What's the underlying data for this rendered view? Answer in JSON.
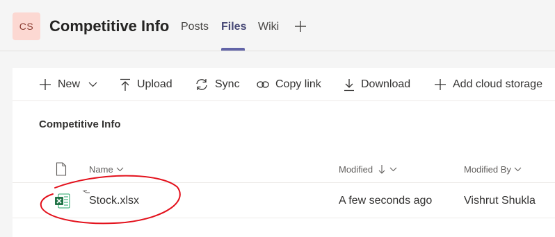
{
  "header": {
    "avatar_initials": "CS",
    "channel_title": "Competitive Info",
    "tabs": [
      {
        "label": "Posts",
        "active": false
      },
      {
        "label": "Files",
        "active": true
      },
      {
        "label": "Wiki",
        "active": false
      }
    ],
    "add_tab_icon": "plus-icon"
  },
  "toolbar": {
    "new_label": "New",
    "upload_label": "Upload",
    "sync_label": "Sync",
    "copy_link_label": "Copy link",
    "download_label": "Download",
    "add_cloud_label": "Add cloud storage"
  },
  "breadcrumb": "Competitive Info",
  "columns": {
    "name": "Name",
    "modified": "Modified",
    "modified_by": "Modified By"
  },
  "files": [
    {
      "name": "Stock.xlsx",
      "icon": "excel-file-icon",
      "modified": "A few seconds ago",
      "modified_by": "Vishrut Shukla"
    }
  ],
  "colors": {
    "accent": "#6264a7",
    "active_tab_text": "#464775",
    "avatar_bg": "#fcd8d2",
    "excel_green": "#217346",
    "annotation_red": "#e3101b"
  }
}
